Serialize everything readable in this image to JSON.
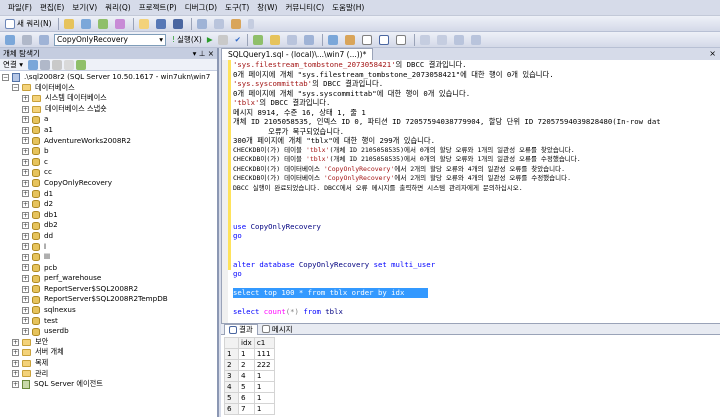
{
  "menu": [
    "파일(F)",
    "편집(E)",
    "보기(V)",
    "쿼리(Q)",
    "프로젝트(P)",
    "디버그(D)",
    "도구(T)",
    "창(W)",
    "커뮤니티(C)",
    "도움말(H)"
  ],
  "toolbar1": {
    "new_query": "새 쿼리(N)"
  },
  "toolbar2": {
    "database": "CopyOnlyRecovery",
    "execute": "실행(X)"
  },
  "colors": {
    "accent": "#3399ff",
    "string": "#a31515",
    "keyword": "#0000ff"
  },
  "object_explorer": {
    "title": "개체 탐색기",
    "connect": "연결",
    "server": ".\\sql2008r2 (SQL Server 10.50.1617 - win7ukn\\win7",
    "databases_folder": "데이터베이스",
    "system_db": "시스템 데이터베이스",
    "db_snapshot": "데이터베이스 스냅숏",
    "databases": [
      "a",
      "a1",
      "AdventureWorks2008R2",
      "b",
      "c",
      "cc",
      "CopyOnlyRecovery",
      "d1",
      "d2",
      "db1",
      "db2",
      "dd",
      "l",
      "lll",
      "pcb",
      "perf_warehouse",
      "ReportServer$SQL2008R2",
      "ReportServer$SQL2008R2TempDB",
      "sqlnexus",
      "test",
      "userdb"
    ],
    "folders": [
      "보안",
      "서버 개체",
      "복제",
      "관리"
    ],
    "agent": "SQL Server 에이전트"
  },
  "editor": {
    "tab_title": "SQLQuery1.sql - (local)\\...\\win7 (...))*",
    "messages": [
      {
        "parts": [
          {
            "t": "'sys.filestream_tombstone_2073058421'",
            "c": "red"
          },
          {
            "t": "의 DBCC 결과입니다."
          }
        ]
      },
      {
        "parts": [
          {
            "t": "0개 페이지에 개체 \"sys.filestream_tombstone_2073058421\"에 대한 행이 0개 있습니다."
          }
        ]
      },
      {
        "parts": [
          {
            "t": "'sys.syscommittab'",
            "c": "red"
          },
          {
            "t": "의 DBCC 결과입니다."
          }
        ]
      },
      {
        "parts": [
          {
            "t": "0개 페이지에 개체 \"sys.syscommittab\"에 대한 행이 0개 있습니다."
          }
        ]
      },
      {
        "parts": [
          {
            "t": "'tblx'",
            "c": "red"
          },
          {
            "t": "의 DBCC 결과입니다."
          }
        ]
      },
      {
        "parts": [
          {
            "t": "메시지 8914, 수준 16, 상태 1, 줄 1"
          }
        ]
      },
      {
        "parts": [
          {
            "t": "개체 ID 2105058535, 인덱스 ID 0, 파티션 ID 72057594038779904, 할당 단위 ID 72057594039828480(In-row dat"
          }
        ]
      },
      {
        "parts": [
          {
            "t": "        오류가 복구되었습니다."
          }
        ]
      },
      {
        "parts": [
          {
            "t": "300개 페이지에 개체 \"tblx\"에 대한 행이 299개 있습니다."
          }
        ]
      },
      {
        "sm": true,
        "parts": [
          {
            "t": "CHECKDB이(가) 테이블 "
          },
          {
            "t": "'tblx'",
            "c": "red"
          },
          {
            "t": "(개체 ID 2105058535)에서 0개의 할당 오류와 1개의 일관성 오류를 찾았습니다."
          }
        ]
      },
      {
        "sm": true,
        "parts": [
          {
            "t": "CHECKDB이(가) 테이블 "
          },
          {
            "t": "'tblx'",
            "c": "red"
          },
          {
            "t": "(개체 ID 2105058535)에서 0개의 할당 오류와 1개의 일관성 오류를 수정했습니다."
          }
        ]
      },
      {
        "sm": true,
        "parts": [
          {
            "t": "CHECKDB이(가) 데이터베이스 "
          },
          {
            "t": "'CopyOnlyRecovery'",
            "c": "red"
          },
          {
            "t": "에서 2개의 할당 오류와 4개의 일관성 오류를 찾았습니다."
          }
        ]
      },
      {
        "sm": true,
        "parts": [
          {
            "t": "CHECKDB이(가) 데이터베이스 "
          },
          {
            "t": "'CopyOnlyRecovery'",
            "c": "red"
          },
          {
            "t": "에서 2개의 할당 오류와 4개의 일관성 오류를 수정했습니다."
          }
        ]
      },
      {
        "sm": true,
        "parts": [
          {
            "t": "DBCC 실행이 완료되었습니다. DBCC에서 오류 메시지를 출력하면 시스템 관리자에게 문의하십시오."
          }
        ]
      },
      {
        "parts": [
          {
            "t": ""
          }
        ]
      },
      {
        "parts": [
          {
            "t": ""
          }
        ]
      },
      {
        "parts": [
          {
            "t": ""
          }
        ]
      },
      {
        "parts": [
          {
            "t": "use",
            "c": "blue"
          },
          {
            "t": " CopyOnlyRecovery",
            "c": "b"
          }
        ]
      },
      {
        "parts": [
          {
            "t": "go",
            "c": "blue"
          }
        ]
      },
      {
        "parts": [
          {
            "t": ""
          }
        ]
      },
      {
        "parts": [
          {
            "t": ""
          }
        ]
      },
      {
        "parts": [
          {
            "t": "alter database",
            "c": "blue"
          },
          {
            "t": " CopyOnlyRecovery ",
            "c": "b"
          },
          {
            "t": "set multi_user",
            "c": "blue"
          }
        ]
      },
      {
        "parts": [
          {
            "t": "go",
            "c": "blue"
          }
        ]
      },
      {
        "parts": [
          {
            "t": ""
          }
        ]
      },
      {
        "sel": true,
        "parts": [
          {
            "t": "select top 100 * from tblx order by idx"
          }
        ]
      },
      {
        "parts": [
          {
            "t": ""
          }
        ]
      },
      {
        "parts": [
          {
            "t": "select",
            "c": "blue"
          },
          {
            "t": " "
          },
          {
            "t": "count",
            "c": "pink"
          },
          {
            "t": "(*) ",
            "c": "gray"
          },
          {
            "t": "from",
            "c": "blue"
          },
          {
            "t": " tblx",
            "c": "b"
          }
        ]
      }
    ]
  },
  "results": {
    "tabs": [
      "결과",
      "메시지"
    ],
    "columns": [
      "idx",
      "c1"
    ],
    "rows": [
      {
        "n": "1",
        "idx": "1",
        "c1": "111"
      },
      {
        "n": "2",
        "idx": "2",
        "c1": "222"
      },
      {
        "n": "3",
        "idx": "4",
        "c1": "1"
      },
      {
        "n": "4",
        "idx": "5",
        "c1": "1"
      },
      {
        "n": "5",
        "idx": "6",
        "c1": "1"
      },
      {
        "n": "6",
        "idx": "7",
        "c1": "1"
      }
    ]
  }
}
